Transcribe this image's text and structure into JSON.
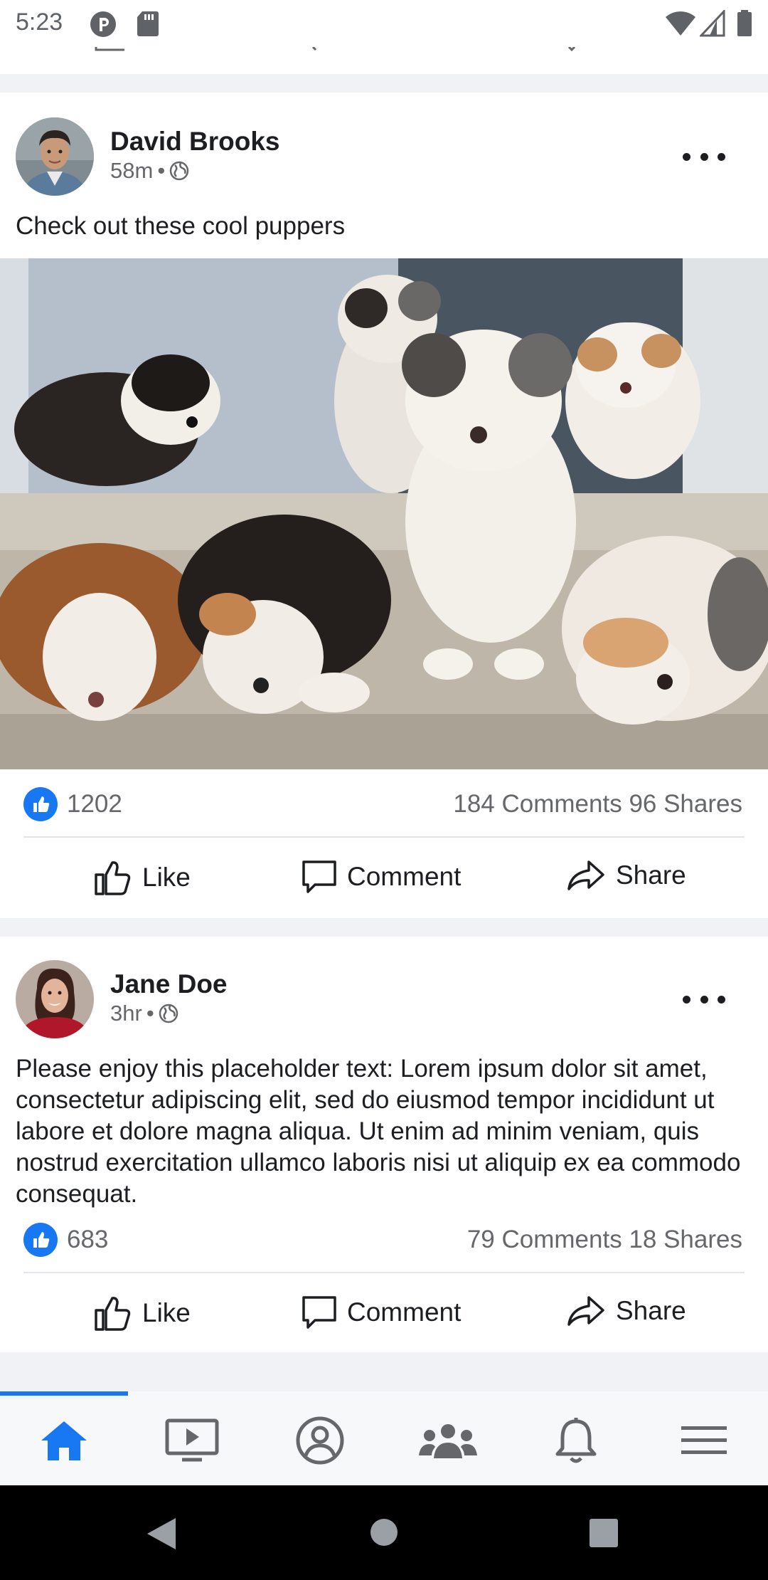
{
  "status_bar": {
    "time": "5:23",
    "left_icons": [
      "p-badge-icon",
      "sd-card-icon"
    ],
    "right_icons": [
      "wifi-icon",
      "cell-signal-icon",
      "battery-icon"
    ]
  },
  "posts": [
    {
      "author": "David Brooks",
      "time_ago": "58m",
      "meta_separator": "•",
      "privacy_icon": "globe-icon",
      "text": "Check out these cool puppers",
      "photo_description_icon": "puppies-photo",
      "likes": "1202",
      "comments": "184 Comments",
      "shares": "96 Shares",
      "actions": {
        "like": "Like",
        "comment": "Comment",
        "share": "Share"
      }
    },
    {
      "author": "Jane Doe",
      "time_ago": "3hr",
      "meta_separator": "•",
      "privacy_icon": "globe-icon",
      "text": "Please enjoy this placeholder text: Lorem ipsum dolor sit amet, consectetur adipiscing elit, sed do eiusmod tempor incididunt ut labore et dolore magna aliqua. Ut enim ad minim veniam, quis nostrud exercitation ullamco laboris nisi ut aliquip ex ea commodo consequat.",
      "likes": "683",
      "comments": "79 Comments",
      "shares": "18 Shares",
      "actions": {
        "like": "Like",
        "comment": "Comment",
        "share": "Share"
      }
    }
  ],
  "bottom_nav": {
    "active": "home",
    "items": [
      "home-icon",
      "video-icon",
      "profile-icon",
      "groups-icon",
      "notifications-icon",
      "menu-icon"
    ]
  },
  "system_nav": [
    "back-icon",
    "home-circle-icon",
    "recents-icon"
  ],
  "colors": {
    "accent": "#1877f2",
    "secondary_text": "#65676b",
    "separator": "#f0f2f5",
    "nav_icon": "#65676b"
  }
}
